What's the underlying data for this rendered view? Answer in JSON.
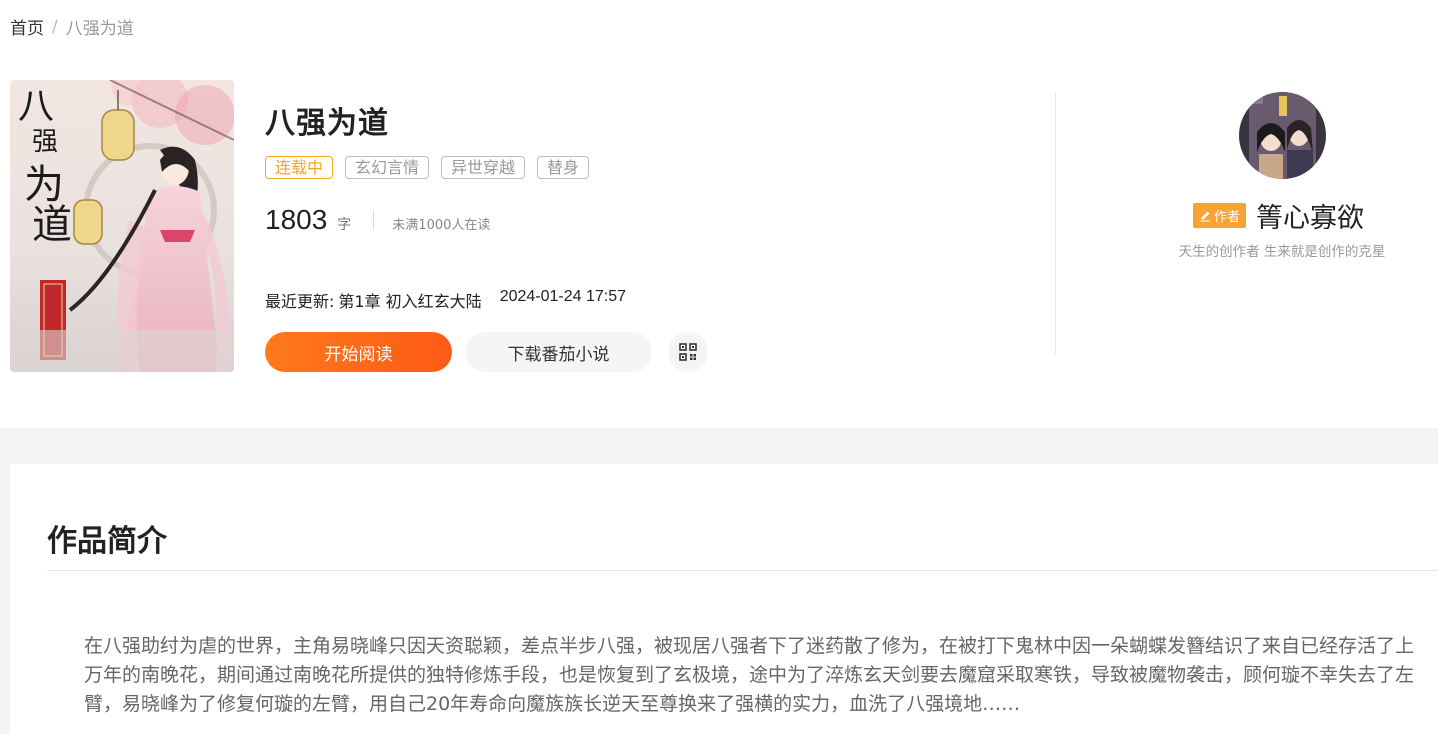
{
  "breadcrumb": {
    "home": "首页",
    "separator": "/",
    "current": "八强为道"
  },
  "cover": {
    "title_chars": [
      "八",
      "强",
      "为",
      "道"
    ]
  },
  "book": {
    "title": "八强为道",
    "tags": [
      {
        "label": "连载中",
        "type": "status"
      },
      {
        "label": "玄幻言情",
        "type": "genre"
      },
      {
        "label": "异世穿越",
        "type": "genre"
      },
      {
        "label": "替身",
        "type": "genre"
      }
    ],
    "word_count": "1803",
    "word_unit": "字",
    "readers": "未满1000人在读",
    "latest_label": "最近更新:",
    "latest_chapter": "第1章 初入红玄大陆",
    "latest_time": "2024-01-24 17:57",
    "read_button": "开始阅读",
    "download_button": "下载番茄小说"
  },
  "author": {
    "badge": "作者",
    "name": "箐心寡欲",
    "bio": "天生的创作者 生来就是创作的克星"
  },
  "intro": {
    "heading": "作品简介",
    "text": "在八强助纣为虐的世界，主角易晓峰只因天资聪颖，差点半步八强，被现居八强者下了迷药散了修为，在被打下鬼林中因一朵蝴蝶发簪结识了来自已经存活了上万年的南晚花，期间通过南晚花所提供的独特修炼手段，也是恢复到了玄极境，途中为了淬炼玄天剑要去魔窟采取寒铁，导致被魔物袭击，顾何璇不幸失去了左臂，易晓峰为了修复何璇的左臂，用自己20年寿命向魔族族长逆天至尊换来了强横的实力，血洗了八强境地……"
  },
  "colors": {
    "accent": "#fe6a17",
    "status_tag": "#f5a623",
    "author_badge": "#f7a433"
  }
}
